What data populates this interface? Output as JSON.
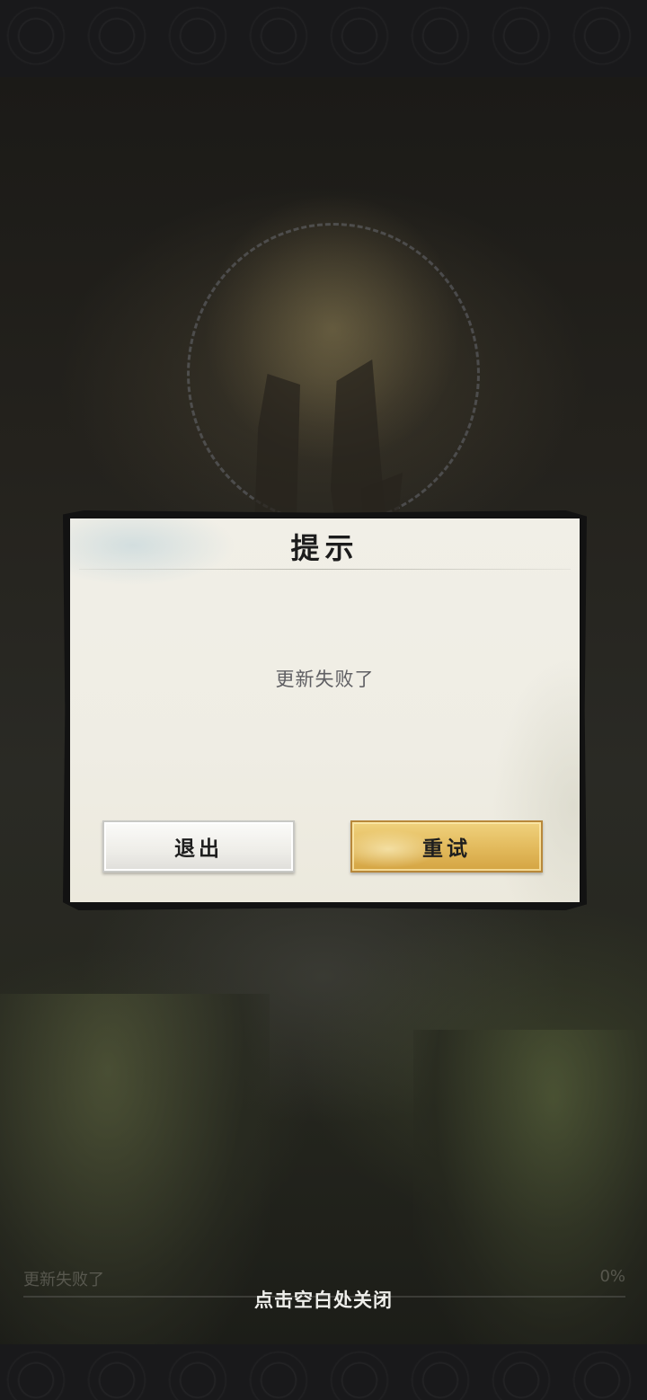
{
  "dialog": {
    "title": "提示",
    "message": "更新失败了",
    "exit_label": "退出",
    "retry_label": "重试"
  },
  "loading": {
    "status_text": "更新失败了",
    "percent_label": "0%",
    "progress": 0
  },
  "overlay": {
    "close_hint": "点击空白处关闭"
  },
  "colors": {
    "accent_gold": "#d4a443",
    "dialog_paper": "#efede4",
    "frame": "#121212"
  }
}
